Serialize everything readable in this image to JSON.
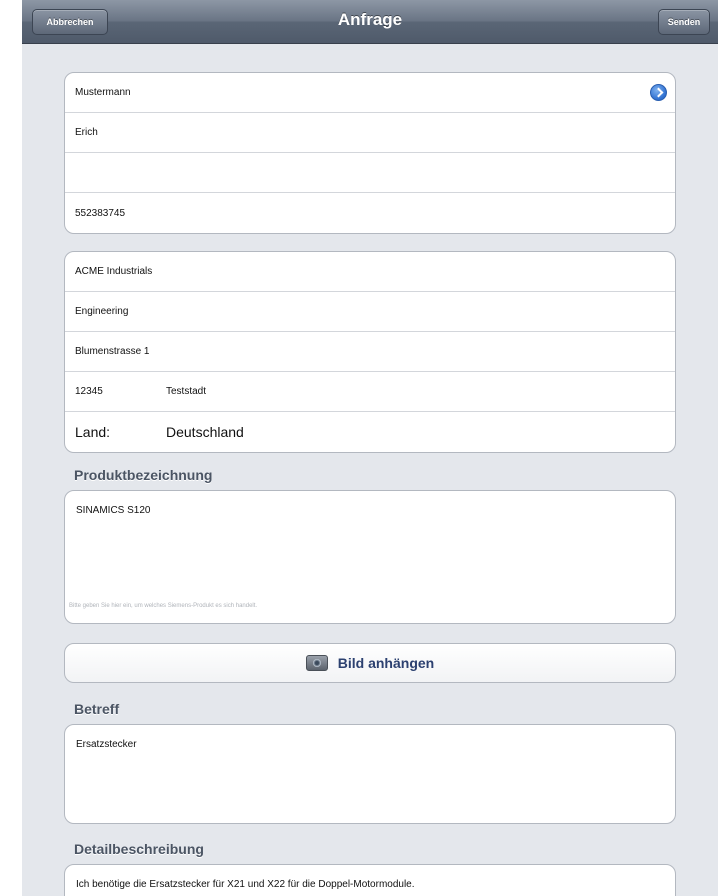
{
  "navbar": {
    "cancel_label": "Abbrechen",
    "title": "Anfrage",
    "send_label": "Senden"
  },
  "contact": {
    "last_name": "Mustermann",
    "first_name": "Erich",
    "empty_field": "",
    "phone": "552383745"
  },
  "company": {
    "name": "ACME Industrials",
    "department": "Engineering",
    "street": "Blumenstrasse 1",
    "zip": "12345",
    "city": "Teststadt",
    "country_label": "Land:",
    "country": "Deutschland"
  },
  "product": {
    "label": "Produktbezeichnung",
    "value": "SINAMICS S120",
    "hint": "Bitte geben Sie hier ein, um welches Siemens-Produkt es sich handelt."
  },
  "attach": {
    "label": "Bild anhängen",
    "icon": "camera-icon"
  },
  "subject": {
    "label": "Betreff",
    "value": "Ersatzstecker"
  },
  "details": {
    "label": "Detailbeschreibung",
    "value": "Ich benötige die Ersatzstecker für X21 und X22 für die Doppel-Motormodule."
  },
  "colors": {
    "background": "#e4e7ec",
    "navbar": "#6a7585",
    "section_label": "#4b5564",
    "attach_label": "#2c4170",
    "disclosure": "#2e6fd0"
  }
}
